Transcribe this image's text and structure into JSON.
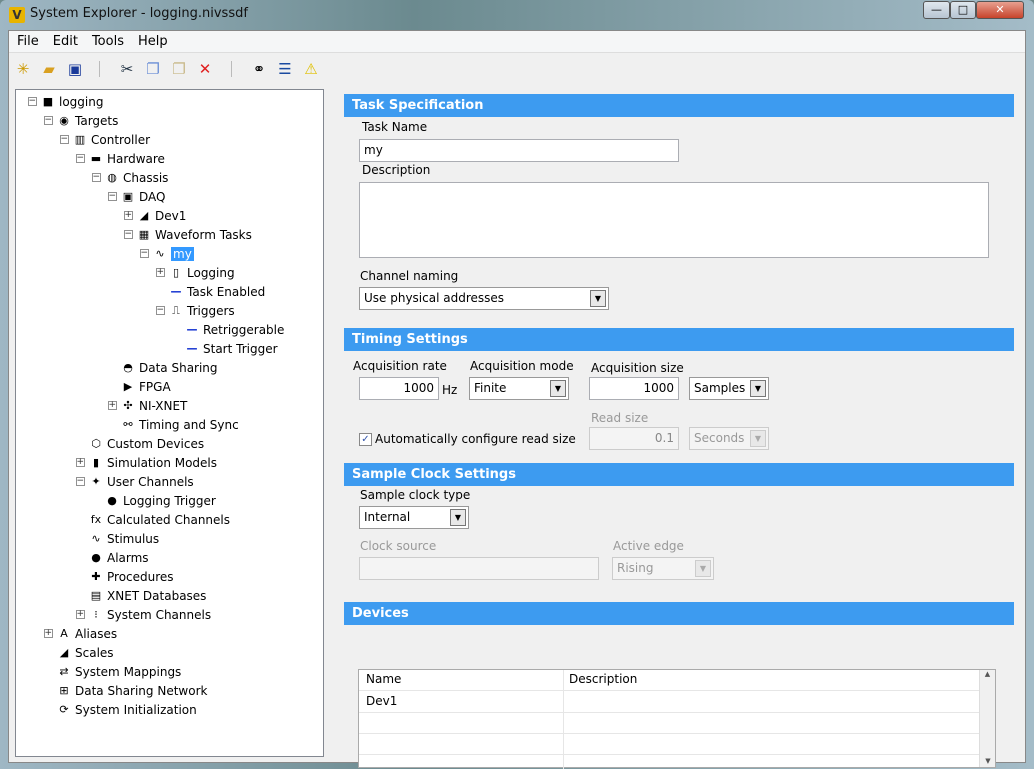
{
  "window": {
    "title": "System Explorer - logging.nivssdf",
    "logo": "V",
    "minimize": "—",
    "maximize": "□",
    "close": "✕"
  },
  "menu": [
    "File",
    "Edit",
    "Tools",
    "Help"
  ],
  "toolbar": [
    "new-icon",
    "open-icon",
    "save-icon",
    "cut-icon",
    "copy-icon",
    "paste-icon",
    "delete-icon",
    "find-icon",
    "channel-list-icon",
    "warning-icon"
  ],
  "tree": [
    {
      "label": "logging",
      "level": 0,
      "exp": "-",
      "icon": "■"
    },
    {
      "label": "Targets",
      "level": 1,
      "exp": "-",
      "icon": "◉"
    },
    {
      "label": "Controller",
      "level": 2,
      "exp": "-",
      "icon": "▥"
    },
    {
      "label": "Hardware",
      "level": 3,
      "exp": "-",
      "icon": "▬"
    },
    {
      "label": "Chassis",
      "level": 4,
      "exp": "-",
      "icon": "◍"
    },
    {
      "label": "DAQ",
      "level": 5,
      "exp": "-",
      "icon": "▣"
    },
    {
      "label": "Dev1",
      "level": 6,
      "exp": "+",
      "icon": "◢"
    },
    {
      "label": "Waveform Tasks",
      "level": 6,
      "exp": "-",
      "icon": "▦"
    },
    {
      "label": "my",
      "level": 7,
      "exp": "-",
      "icon": "∿",
      "selected": true
    },
    {
      "label": "Logging",
      "level": 8,
      "exp": "+",
      "icon": "▯"
    },
    {
      "label": "Task Enabled",
      "level": 8,
      "exp": "",
      "icon": "—"
    },
    {
      "label": "Triggers",
      "level": 8,
      "exp": "-",
      "icon": "⎍"
    },
    {
      "label": "Retriggerable",
      "level": 9,
      "exp": "",
      "icon": "—"
    },
    {
      "label": "Start Trigger",
      "level": 9,
      "exp": "",
      "icon": "—"
    },
    {
      "label": "Data Sharing",
      "level": 5,
      "exp": "",
      "icon": "◓"
    },
    {
      "label": "FPGA",
      "level": 5,
      "exp": "",
      "icon": "▶"
    },
    {
      "label": "NI-XNET",
      "level": 5,
      "exp": "+",
      "icon": "✣"
    },
    {
      "label": "Timing and Sync",
      "level": 5,
      "exp": "",
      "icon": "⚯"
    },
    {
      "label": "Custom Devices",
      "level": 3,
      "exp": "",
      "icon": "⬡"
    },
    {
      "label": "Simulation Models",
      "level": 3,
      "exp": "+",
      "icon": "▮"
    },
    {
      "label": "User Channels",
      "level": 3,
      "exp": "-",
      "icon": "✦"
    },
    {
      "label": "Logging Trigger",
      "level": 4,
      "exp": "",
      "icon": "●"
    },
    {
      "label": "Calculated Channels",
      "level": 3,
      "exp": "",
      "icon": "fx"
    },
    {
      "label": "Stimulus",
      "level": 3,
      "exp": "",
      "icon": "∿"
    },
    {
      "label": "Alarms",
      "level": 3,
      "exp": "",
      "icon": "●"
    },
    {
      "label": "Procedures",
      "level": 3,
      "exp": "",
      "icon": "✚"
    },
    {
      "label": "XNET Databases",
      "level": 3,
      "exp": "",
      "icon": "▤"
    },
    {
      "label": "System Channels",
      "level": 3,
      "exp": "+",
      "icon": "⁝"
    },
    {
      "label": "Aliases",
      "level": 1,
      "exp": "+",
      "icon": "A"
    },
    {
      "label": "Scales",
      "level": 1,
      "exp": "",
      "icon": "◢"
    },
    {
      "label": "System Mappings",
      "level": 1,
      "exp": "",
      "icon": "⇄"
    },
    {
      "label": "Data Sharing Network",
      "level": 1,
      "exp": "",
      "icon": "⊞"
    },
    {
      "label": "System Initialization",
      "level": 1,
      "exp": "",
      "icon": "⟳"
    }
  ],
  "task": {
    "header": "Task Specification",
    "name_label": "Task Name",
    "name": "my",
    "desc_label": "Description",
    "desc": "",
    "naming_label": "Channel naming",
    "naming": "Use physical addresses"
  },
  "timing": {
    "header": "Timing Settings",
    "rate_label": "Acquisition rate",
    "rate": "1000",
    "rate_unit": "Hz",
    "mode_label": "Acquisition mode",
    "mode": "Finite",
    "size_label": "Acquisition size",
    "size": "1000",
    "size_unit": "Samples",
    "auto_label": "Automatically configure read size",
    "auto_checked": true,
    "read_label": "Read size",
    "read": "0.1",
    "read_unit": "Seconds"
  },
  "clock": {
    "header": "Sample Clock Settings",
    "type_label": "Sample clock type",
    "type": "Internal",
    "source_label": "Clock source",
    "source": "",
    "edge_label": "Active edge",
    "edge": "Rising"
  },
  "devices": {
    "header": "Devices",
    "columns": [
      "Name",
      "Description"
    ],
    "rows": [
      [
        "Dev1",
        ""
      ]
    ]
  },
  "colors": {
    "header": "#3d9bf0",
    "selection": "#3399ff"
  }
}
